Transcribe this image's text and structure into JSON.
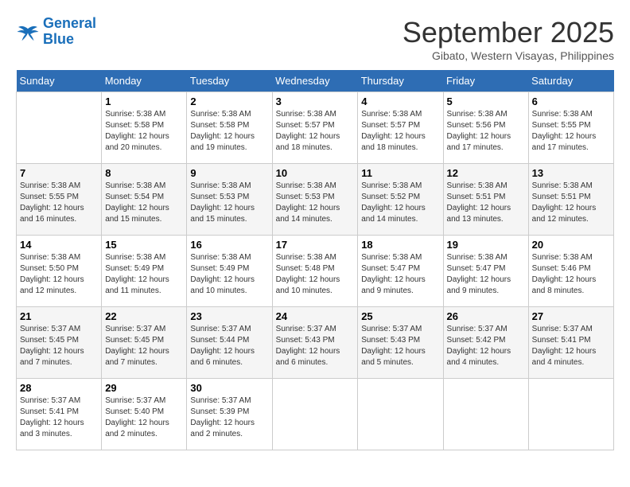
{
  "header": {
    "logo_line1": "General",
    "logo_line2": "Blue",
    "month": "September 2025",
    "location": "Gibato, Western Visayas, Philippines"
  },
  "days_of_week": [
    "Sunday",
    "Monday",
    "Tuesday",
    "Wednesday",
    "Thursday",
    "Friday",
    "Saturday"
  ],
  "weeks": [
    [
      {
        "day": "",
        "info": ""
      },
      {
        "day": "1",
        "info": "Sunrise: 5:38 AM\nSunset: 5:58 PM\nDaylight: 12 hours\nand 20 minutes."
      },
      {
        "day": "2",
        "info": "Sunrise: 5:38 AM\nSunset: 5:58 PM\nDaylight: 12 hours\nand 19 minutes."
      },
      {
        "day": "3",
        "info": "Sunrise: 5:38 AM\nSunset: 5:57 PM\nDaylight: 12 hours\nand 18 minutes."
      },
      {
        "day": "4",
        "info": "Sunrise: 5:38 AM\nSunset: 5:57 PM\nDaylight: 12 hours\nand 18 minutes."
      },
      {
        "day": "5",
        "info": "Sunrise: 5:38 AM\nSunset: 5:56 PM\nDaylight: 12 hours\nand 17 minutes."
      },
      {
        "day": "6",
        "info": "Sunrise: 5:38 AM\nSunset: 5:55 PM\nDaylight: 12 hours\nand 17 minutes."
      }
    ],
    [
      {
        "day": "7",
        "info": "Sunrise: 5:38 AM\nSunset: 5:55 PM\nDaylight: 12 hours\nand 16 minutes."
      },
      {
        "day": "8",
        "info": "Sunrise: 5:38 AM\nSunset: 5:54 PM\nDaylight: 12 hours\nand 15 minutes."
      },
      {
        "day": "9",
        "info": "Sunrise: 5:38 AM\nSunset: 5:53 PM\nDaylight: 12 hours\nand 15 minutes."
      },
      {
        "day": "10",
        "info": "Sunrise: 5:38 AM\nSunset: 5:53 PM\nDaylight: 12 hours\nand 14 minutes."
      },
      {
        "day": "11",
        "info": "Sunrise: 5:38 AM\nSunset: 5:52 PM\nDaylight: 12 hours\nand 14 minutes."
      },
      {
        "day": "12",
        "info": "Sunrise: 5:38 AM\nSunset: 5:51 PM\nDaylight: 12 hours\nand 13 minutes."
      },
      {
        "day": "13",
        "info": "Sunrise: 5:38 AM\nSunset: 5:51 PM\nDaylight: 12 hours\nand 12 minutes."
      }
    ],
    [
      {
        "day": "14",
        "info": "Sunrise: 5:38 AM\nSunset: 5:50 PM\nDaylight: 12 hours\nand 12 minutes."
      },
      {
        "day": "15",
        "info": "Sunrise: 5:38 AM\nSunset: 5:49 PM\nDaylight: 12 hours\nand 11 minutes."
      },
      {
        "day": "16",
        "info": "Sunrise: 5:38 AM\nSunset: 5:49 PM\nDaylight: 12 hours\nand 10 minutes."
      },
      {
        "day": "17",
        "info": "Sunrise: 5:38 AM\nSunset: 5:48 PM\nDaylight: 12 hours\nand 10 minutes."
      },
      {
        "day": "18",
        "info": "Sunrise: 5:38 AM\nSunset: 5:47 PM\nDaylight: 12 hours\nand 9 minutes."
      },
      {
        "day": "19",
        "info": "Sunrise: 5:38 AM\nSunset: 5:47 PM\nDaylight: 12 hours\nand 9 minutes."
      },
      {
        "day": "20",
        "info": "Sunrise: 5:38 AM\nSunset: 5:46 PM\nDaylight: 12 hours\nand 8 minutes."
      }
    ],
    [
      {
        "day": "21",
        "info": "Sunrise: 5:37 AM\nSunset: 5:45 PM\nDaylight: 12 hours\nand 7 minutes."
      },
      {
        "day": "22",
        "info": "Sunrise: 5:37 AM\nSunset: 5:45 PM\nDaylight: 12 hours\nand 7 minutes."
      },
      {
        "day": "23",
        "info": "Sunrise: 5:37 AM\nSunset: 5:44 PM\nDaylight: 12 hours\nand 6 minutes."
      },
      {
        "day": "24",
        "info": "Sunrise: 5:37 AM\nSunset: 5:43 PM\nDaylight: 12 hours\nand 6 minutes."
      },
      {
        "day": "25",
        "info": "Sunrise: 5:37 AM\nSunset: 5:43 PM\nDaylight: 12 hours\nand 5 minutes."
      },
      {
        "day": "26",
        "info": "Sunrise: 5:37 AM\nSunset: 5:42 PM\nDaylight: 12 hours\nand 4 minutes."
      },
      {
        "day": "27",
        "info": "Sunrise: 5:37 AM\nSunset: 5:41 PM\nDaylight: 12 hours\nand 4 minutes."
      }
    ],
    [
      {
        "day": "28",
        "info": "Sunrise: 5:37 AM\nSunset: 5:41 PM\nDaylight: 12 hours\nand 3 minutes."
      },
      {
        "day": "29",
        "info": "Sunrise: 5:37 AM\nSunset: 5:40 PM\nDaylight: 12 hours\nand 2 minutes."
      },
      {
        "day": "30",
        "info": "Sunrise: 5:37 AM\nSunset: 5:39 PM\nDaylight: 12 hours\nand 2 minutes."
      },
      {
        "day": "",
        "info": ""
      },
      {
        "day": "",
        "info": ""
      },
      {
        "day": "",
        "info": ""
      },
      {
        "day": "",
        "info": ""
      }
    ]
  ]
}
